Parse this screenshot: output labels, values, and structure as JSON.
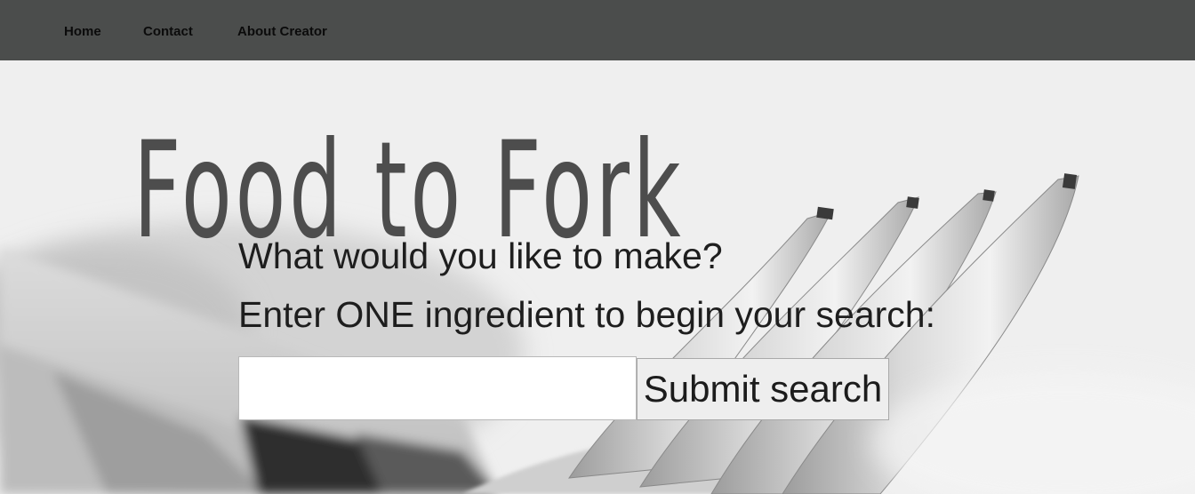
{
  "nav": {
    "items": [
      {
        "label": "Home"
      },
      {
        "label": "Contact"
      },
      {
        "label": "About Creator"
      }
    ]
  },
  "hero": {
    "title": "Food to Fork",
    "prompt_line_1": "What would you like to make?",
    "prompt_line_2": "Enter ONE ingredient to begin your search:",
    "search": {
      "value": "",
      "placeholder": ""
    },
    "submit_label": "Submit search"
  },
  "colors": {
    "navbar": "#4b4d4c",
    "title": "#4d4d4d",
    "text": "#1e1e1e"
  },
  "icons": {
    "background": "fork-photo"
  }
}
